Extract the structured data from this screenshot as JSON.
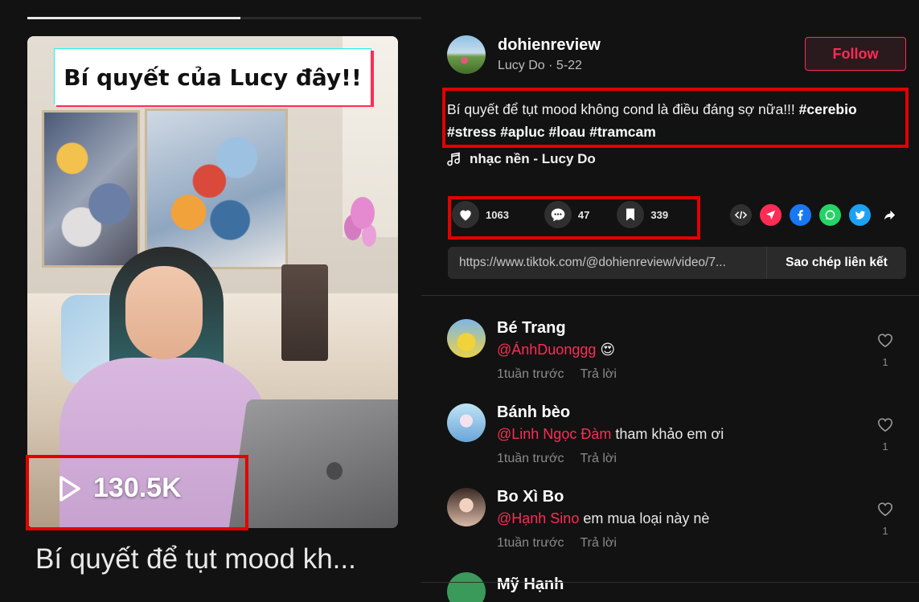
{
  "video": {
    "progress_percent": 54,
    "overlay_caption": "Bí quyết của Lucy đây!!",
    "views": "130.5K",
    "title": "Bí quyết để tụt mood kh..."
  },
  "author": {
    "username": "dohienreview",
    "display_name_date": "Lucy Do · 5-22",
    "follow_label": "Follow"
  },
  "description": {
    "text": "Bí quyết để tụt mood không cond là điều đáng sợ nữa!!! ",
    "hashtags": [
      "#cerebio",
      "#stress",
      "#apluc",
      "#loau",
      "#tramcam"
    ]
  },
  "music": {
    "label": "nhạc nền - Lucy Do"
  },
  "stats": {
    "likes": "1063",
    "comments": "47",
    "saves": "339"
  },
  "share": {
    "icons": [
      "embed-icon",
      "send-icon",
      "facebook-icon",
      "whatsapp-icon",
      "twitter-icon",
      "share-arrow-icon"
    ],
    "link_url": "https://www.tiktok.com/@dohienreview/video/7...",
    "copy_label": "Sao chép liên kết"
  },
  "comments": [
    {
      "name": "Bé Trang",
      "mention": "@ÁnhDuonggg",
      "text": " 😍",
      "time": "1tuần trước",
      "reply": "Trả lời",
      "likes": "1"
    },
    {
      "name": "Bánh bèo",
      "mention": "@Linh Ngọc Đàm",
      "text": " tham khảo em ơi",
      "time": "1tuần trước",
      "reply": "Trả lời",
      "likes": "1"
    },
    {
      "name": "Bo Xì Bo",
      "mention": "@Hạnh Sino",
      "text": " em mua loại này nè",
      "time": "1tuần trước",
      "reply": "Trả lời",
      "likes": "1"
    }
  ],
  "partial_comment": {
    "name": "Mỹ Hạnh"
  },
  "colors": {
    "accent": "#fe2c55",
    "highlight_box": "#e30000",
    "background": "#121212"
  }
}
